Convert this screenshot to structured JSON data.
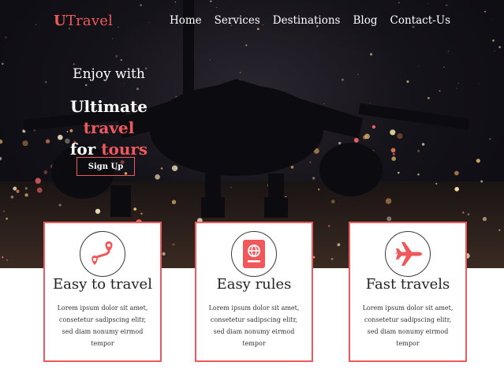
{
  "brand": {
    "logo_first": "U",
    "logo_rest": "Travel",
    "accent_color": "#f0595b"
  },
  "nav": {
    "items": [
      {
        "label": "Home"
      },
      {
        "label": "Services"
      },
      {
        "label": "Destinations"
      },
      {
        "label": "Blog"
      },
      {
        "label": "Contact-Us"
      }
    ]
  },
  "hero": {
    "tagline": "Enjoy with",
    "headline_part1": "Ultimate ",
    "headline_accent1": "travel",
    "headline_part2": "for ",
    "headline_accent2": "tours",
    "signup_label": "Sign Up"
  },
  "features": [
    {
      "icon": "route-icon",
      "title": "Easy to travel",
      "text": "Lorem ipsum dolor sit amet, consetetur sadipscing elitr, sed diam nonumy eirmod tempor"
    },
    {
      "icon": "passport-icon",
      "title": "Easy rules",
      "text": "Lorem ipsum dolor sit amet, consetetur sadipscing elitr, sed diam nonumy eirmod tempor"
    },
    {
      "icon": "airplane-icon",
      "title": "Fast travels",
      "text": "Lorem ipsum dolor sit amet, consetetur sadipscing elitr, sed diam nonumy eirmod tempor"
    }
  ]
}
